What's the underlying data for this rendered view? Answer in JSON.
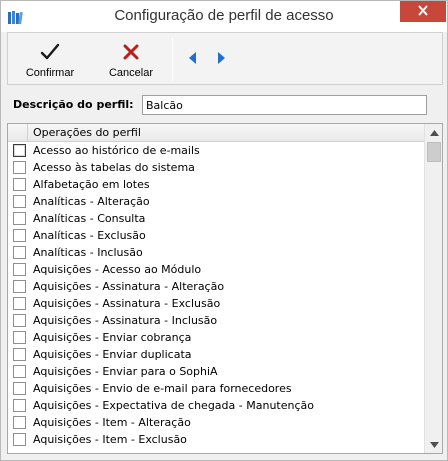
{
  "window": {
    "title": "Configuração de perfil de acesso"
  },
  "toolbar": {
    "confirm_label": "Confirmar",
    "cancel_label": "Cancelar"
  },
  "form": {
    "description_label": "Descrição do perfil:",
    "description_value": "Balcão"
  },
  "list": {
    "column_header": "Operações do perfil",
    "items": [
      "Acesso ao histórico de e-mails",
      "Acesso às tabelas do sistema",
      "Alfabetação em lotes",
      "Analíticas - Alteração",
      "Analíticas - Consulta",
      "Analíticas - Exclusão",
      "Analíticas - Inclusão",
      "Aquisições - Acesso ao Módulo",
      "Aquisições - Assinatura - Alteração",
      "Aquisições - Assinatura - Exclusão",
      "Aquisições - Assinatura - Inclusão",
      "Aquisições - Enviar cobrança",
      "Aquisições - Enviar duplicata",
      "Aquisições - Enviar para o SophiA",
      "Aquisições - Envio de e-mail para fornecedores",
      "Aquisições - Expectativa de chegada - Manutenção",
      "Aquisições - Item - Alteração",
      "Aquisições - Item - Exclusão"
    ]
  },
  "colors": {
    "close_button": "#c7473a",
    "confirm_check": "#1a1a1a",
    "cancel_x": "#b8201b",
    "nav_arrow": "#1e6fd0"
  },
  "icons": {
    "app": "books-icon",
    "close": "close-icon",
    "confirm": "checkmark-icon",
    "cancel": "x-icon",
    "prev": "arrow-left-icon",
    "next": "arrow-right-icon"
  }
}
